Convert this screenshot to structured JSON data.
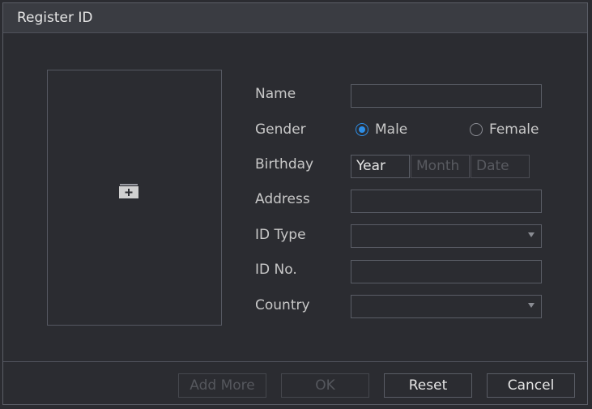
{
  "dialog": {
    "title": "Register ID"
  },
  "photo": {
    "add_icon": "add-photo-icon"
  },
  "form": {
    "name_label": "Name",
    "name_value": "",
    "gender_label": "Gender",
    "gender_options": [
      "Male",
      "Female"
    ],
    "gender_selected": "Male",
    "birthday_label": "Birthday",
    "birthday_year": "Year",
    "birthday_month": "Month",
    "birthday_date": "Date",
    "address_label": "Address",
    "address_value": "",
    "id_type_label": "ID Type",
    "id_type_value": "",
    "id_no_label": "ID No.",
    "id_no_value": "",
    "country_label": "Country",
    "country_value": ""
  },
  "buttons": {
    "add_more": "Add More",
    "ok": "OK",
    "reset": "Reset",
    "cancel": "Cancel"
  },
  "colors": {
    "accent": "#2e8ee6",
    "background": "#2b2c31",
    "titlebar": "#3a3c42"
  }
}
